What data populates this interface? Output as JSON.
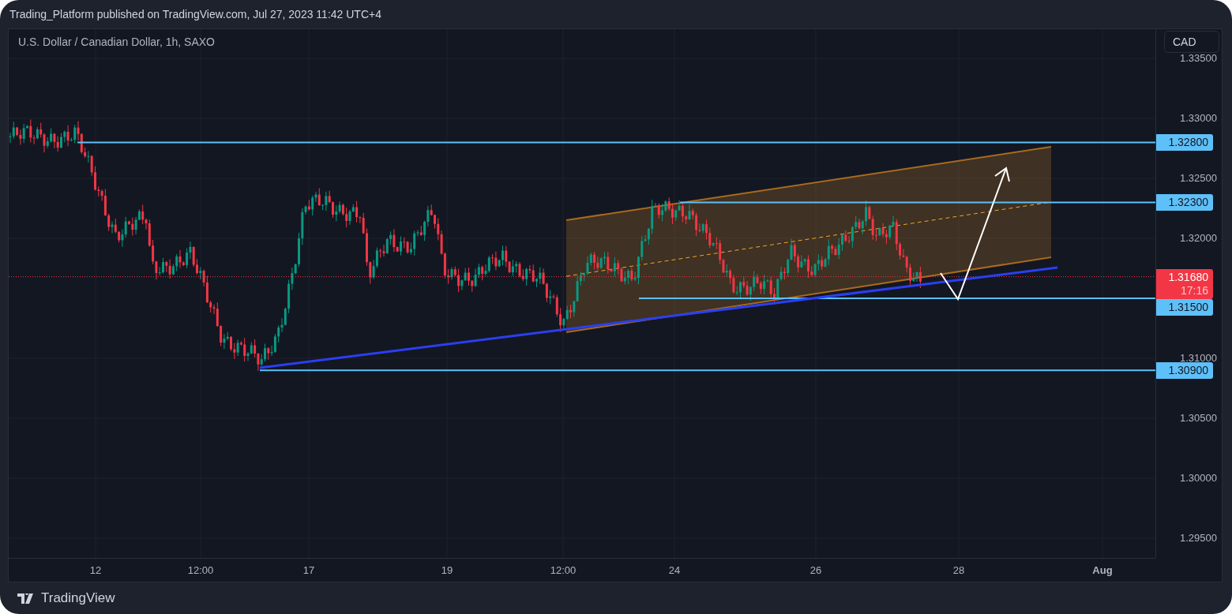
{
  "header": {
    "title": "Trading_Platform published on TradingView.com, Jul 27, 2023 11:42 UTC+4"
  },
  "chart": {
    "legend": "U.S. Dollar / Canadian Dollar, 1h, SAXO",
    "currency_button": "CAD",
    "price_axis": [
      "1.33500",
      "1.33000",
      "1.32500",
      "1.32000",
      "1.31000",
      "1.30500",
      "1.30000",
      "1.29500"
    ],
    "time_axis": [
      "12",
      "12:00",
      "17",
      "19",
      "12:00",
      "24",
      "26",
      "28",
      "Aug"
    ],
    "price_markers": [
      {
        "kind": "level",
        "price": "1.32800"
      },
      {
        "kind": "level",
        "price": "1.32300"
      },
      {
        "kind": "last",
        "price": "1.31680",
        "countdown": "17:16"
      },
      {
        "kind": "level",
        "price": "1.31500"
      },
      {
        "kind": "level",
        "price": "1.30900"
      }
    ]
  },
  "footer": {
    "brand": "TradingView"
  }
}
